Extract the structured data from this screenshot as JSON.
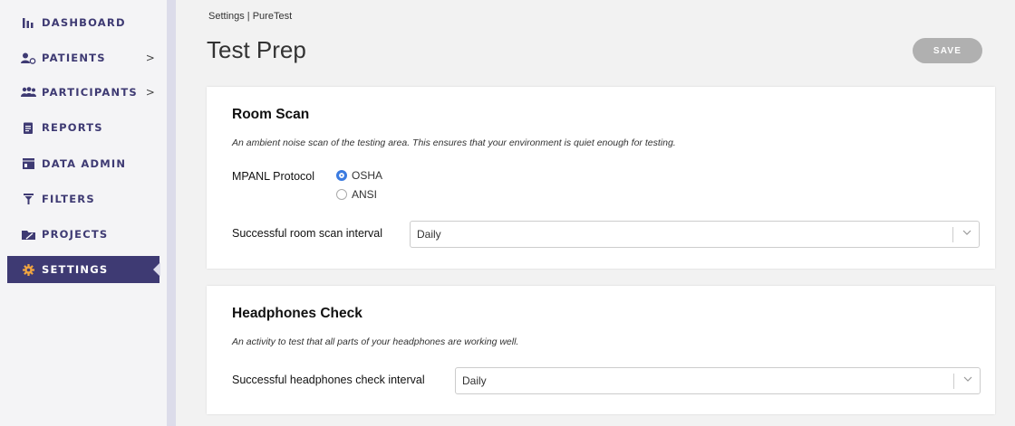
{
  "sidebar": {
    "items": [
      {
        "label": "DASHBOARD",
        "icon": "bar-chart-icon"
      },
      {
        "label": "PATIENTS",
        "icon": "patient-icon",
        "chevron": ">"
      },
      {
        "label": "PARTICIPANTS",
        "icon": "participants-icon",
        "chevron": ">"
      },
      {
        "label": "REPORTS",
        "icon": "clipboard-icon"
      },
      {
        "label": "DATA ADMIN",
        "icon": "data-admin-icon"
      },
      {
        "label": "FILTERS",
        "icon": "filter-icon"
      },
      {
        "label": "PROJECTS",
        "icon": "projects-icon"
      },
      {
        "label": "SETTINGS",
        "icon": "gear-icon",
        "active": true
      }
    ]
  },
  "header": {
    "breadcrumb": "Settings | PureTest",
    "title": "Test Prep",
    "save_label": "SAVE"
  },
  "room_scan": {
    "title": "Room Scan",
    "description": "An ambient noise scan of the testing area. This ensures that your environment is quiet enough for testing.",
    "protocol_label": "MPANL Protocol",
    "options": [
      "OSHA",
      "ANSI"
    ],
    "selected": "OSHA",
    "interval_label": "Successful room scan interval",
    "interval_value": "Daily"
  },
  "headphones": {
    "title": "Headphones Check",
    "description": "An activity to test that all parts of your headphones are working well.",
    "interval_label": "Successful headphones check interval",
    "interval_value": "Daily"
  },
  "colors": {
    "accent": "#3e3a73",
    "radio_on": "#3b7be0",
    "save_disabled": "#b0b0b0"
  }
}
